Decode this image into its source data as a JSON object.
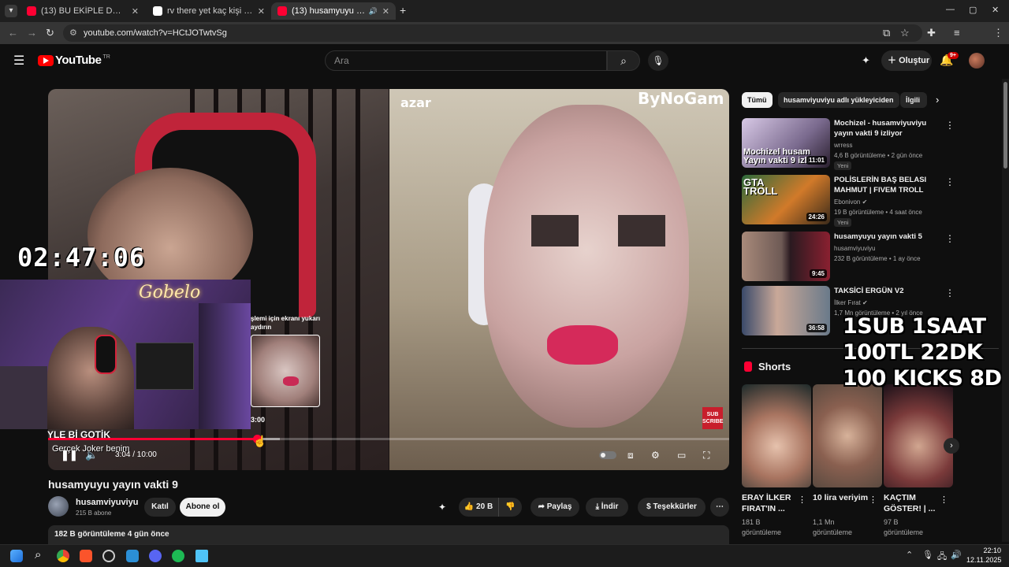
{
  "browser": {
    "tabs": [
      {
        "title": "(13) BU EKİPLE DAĞA TIRMANMAK",
        "close": "✕"
      },
      {
        "title": "rv there yet kaç kişi - Google'da Ara",
        "close": "✕"
      },
      {
        "title": "(13) husamyuyu yayın vakti 9",
        "close": "✕",
        "audio": "🔊"
      }
    ],
    "new_tab": "+",
    "url": "youtube.com/watch?v=HCtJOTwtvSg",
    "window_controls": [
      "—",
      "▢",
      "✕"
    ]
  },
  "header": {
    "logo_text": "YouTube",
    "logo_country": "TR",
    "search_placeholder": "Ara",
    "create_label": "Oluştur",
    "notif_badge": "9+"
  },
  "player": {
    "timer": "02:47:06",
    "watermark_left": "azar",
    "watermark_right": "ByNoGam",
    "neon_sign": "Gobelo",
    "sub_badge": "SUB SCRIBE",
    "preview_text": "şlemi için ekranı yukarı aydırın",
    "preview_time": "3:00",
    "caption_line1": "YLE Bİ GOTİK",
    "caption_line2": "Gerçek Joker benim",
    "current_time": "3:04 / 10:00",
    "progress_fraction": 0.307,
    "loaded_fraction": 0.34
  },
  "video": {
    "title": "husamyuyu yayın vakti 9",
    "channel": "husamviyuviyu",
    "subscribers": "215 B abone",
    "join_label": "Katıl",
    "subscribe_label": "Abone ol",
    "like_count": "20 B",
    "share_label": "Paylaş",
    "download_label": "İndir",
    "thanks_label": "Teşekkürler",
    "views_date": "182 B görüntüleme  4 gün önce"
  },
  "sidebar": {
    "chips": [
      "Tümü",
      "husamviyuviyu adlı yükleyiciden",
      "İlgili"
    ],
    "recommendations": [
      {
        "title": "Mochizel - husamviyuviyu yayın vakti 9 izliyor",
        "channel": "wrress",
        "meta": "4,6 B görüntüleme • 2 gün önce",
        "badge": "Yeni",
        "duration": "11:01",
        "thumb_text": "Mochizel husam Yayın vakti 9 izli"
      },
      {
        "title": "POLİSLERİN BAŞ BELASI MAHMUT | FIVEM TROLL",
        "channel": "Ebonivon ✔",
        "meta": "19 B görüntüleme • 4 saat önce",
        "badge": "Yeni",
        "duration": "24:26",
        "thumb_text": "GTA TROLL"
      },
      {
        "title": "husamyuyu yayın vakti 5",
        "channel": "husamviyuviyu",
        "meta": "232 B görüntüleme • 1 ay önce",
        "badge": "",
        "duration": "9:45",
        "thumb_text": ""
      },
      {
        "title": "TAKSİCİ ERGÜN V2",
        "channel": "İlker Fırat ✔",
        "meta": "1,7 Mn görüntüleme • 2 yıl önce",
        "badge": "",
        "duration": "36:58",
        "thumb_text": ""
      }
    ],
    "shorts_heading": "Shorts",
    "shorts": [
      {
        "title": "ERAY İLKER FIRAT'IN ...",
        "views": "181 B görüntüleme"
      },
      {
        "title": "10 lira veriyim",
        "views": "1,1 Mn görüntüleme"
      },
      {
        "title": "KAÇTIM GÖSTER! | ...",
        "views": "97 B görüntüleme"
      }
    ],
    "promo_lines": [
      "1SUB 1SAAT",
      "100TL 22DK",
      "100 KICKS 8DK"
    ]
  },
  "taskbar": {
    "time": "22:10",
    "date": "12.11.2025"
  },
  "colors": {
    "yt_red": "#ff0033",
    "bg": "#0f0f0f"
  }
}
